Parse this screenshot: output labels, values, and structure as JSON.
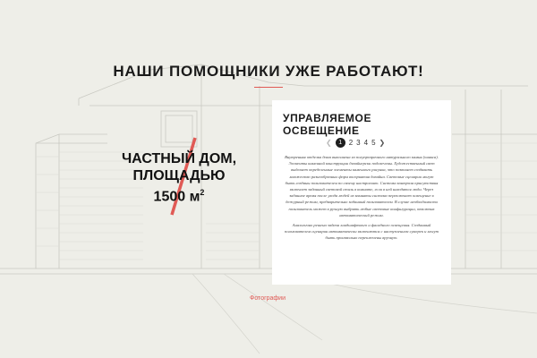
{
  "page": {
    "title": "НАШИ ПОМОЩНИКИ УЖЕ РАБОТАЮТ!",
    "accent_color": "#e05a55",
    "background_color": "#eeeee8"
  },
  "house_caption": {
    "line1": "ЧАСТНЫЙ ДОМ,",
    "line2": "ПЛОЩАДЬЮ",
    "area": "1500 м",
    "area_sup": "2"
  },
  "panel": {
    "title": "УПРАВЛЯЕМОЕ ОСВЕЩЕНИЕ",
    "pager": {
      "prev_icon": "chevron-left-icon",
      "next_icon": "chevron-right-icon",
      "pages": [
        "1",
        "2",
        "3",
        "4",
        "5"
      ],
      "active_index": 0
    },
    "paragraph1": "Внутренняя отделка дома выполнена из полупрозрачного натурального камня (оникса). Элементы каменной конструкции дизайнерски подсвечены. Художественный свет выделяет определенные элементы каменного рисунка, что позволяет создавать множество разнообразных форм восприятия дизайна. Световые сценарии могут быть созданы пользователем по своему настроению. Система контроля присутствия включает заданный световой стиль в комнате, если в ней находятся люди. Через заданное время после ухода людей из комнаты система переключает освещение в дежурный режим, предварительно заданный пользователем. В случае необходимости пользователь может в ручную выбрать любые световые конфигурации, отключив автоматический режим.",
    "paragraph2": "Аналогично решена задача ландшафтного и фасадного освещения. Созданный пользователем сценарии автоматически включаются с наступлением сумерек и могут быть произвольно переключены вручную."
  },
  "photos_link": {
    "label": "Фотографии"
  }
}
